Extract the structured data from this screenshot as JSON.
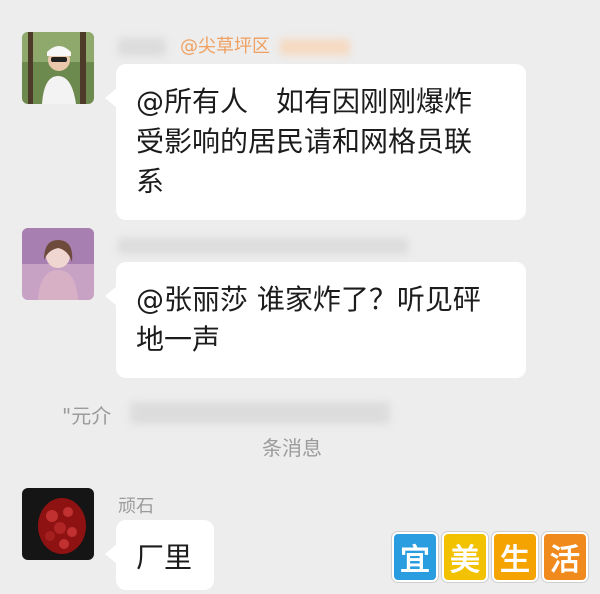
{
  "messages": [
    {
      "sender": "@尖草坪区",
      "text_lines": [
        "@所有人　如有因刚刚爆炸",
        "受影响的居民请和网格员联",
        "系"
      ]
    },
    {
      "sender": "",
      "text_lines": [
        "@张丽莎  谁家炸了？听见砰",
        "地一声"
      ]
    },
    {
      "sender": "顽石",
      "text_lines": [
        "厂里"
      ]
    }
  ],
  "system_notice": {
    "quote_fragment": "\"元介",
    "unread_text": "条消息"
  },
  "watermark": {
    "characters": [
      "宜",
      "美",
      "生",
      "活"
    ],
    "colors": [
      "#2a9de0",
      "#f2c200",
      "#f4a300",
      "#f08a1c"
    ]
  },
  "colors": {
    "background": "#ededed",
    "bubble": "#ffffff",
    "sender_text": "#9a9a9a",
    "message_text": "#1c1c1c"
  }
}
